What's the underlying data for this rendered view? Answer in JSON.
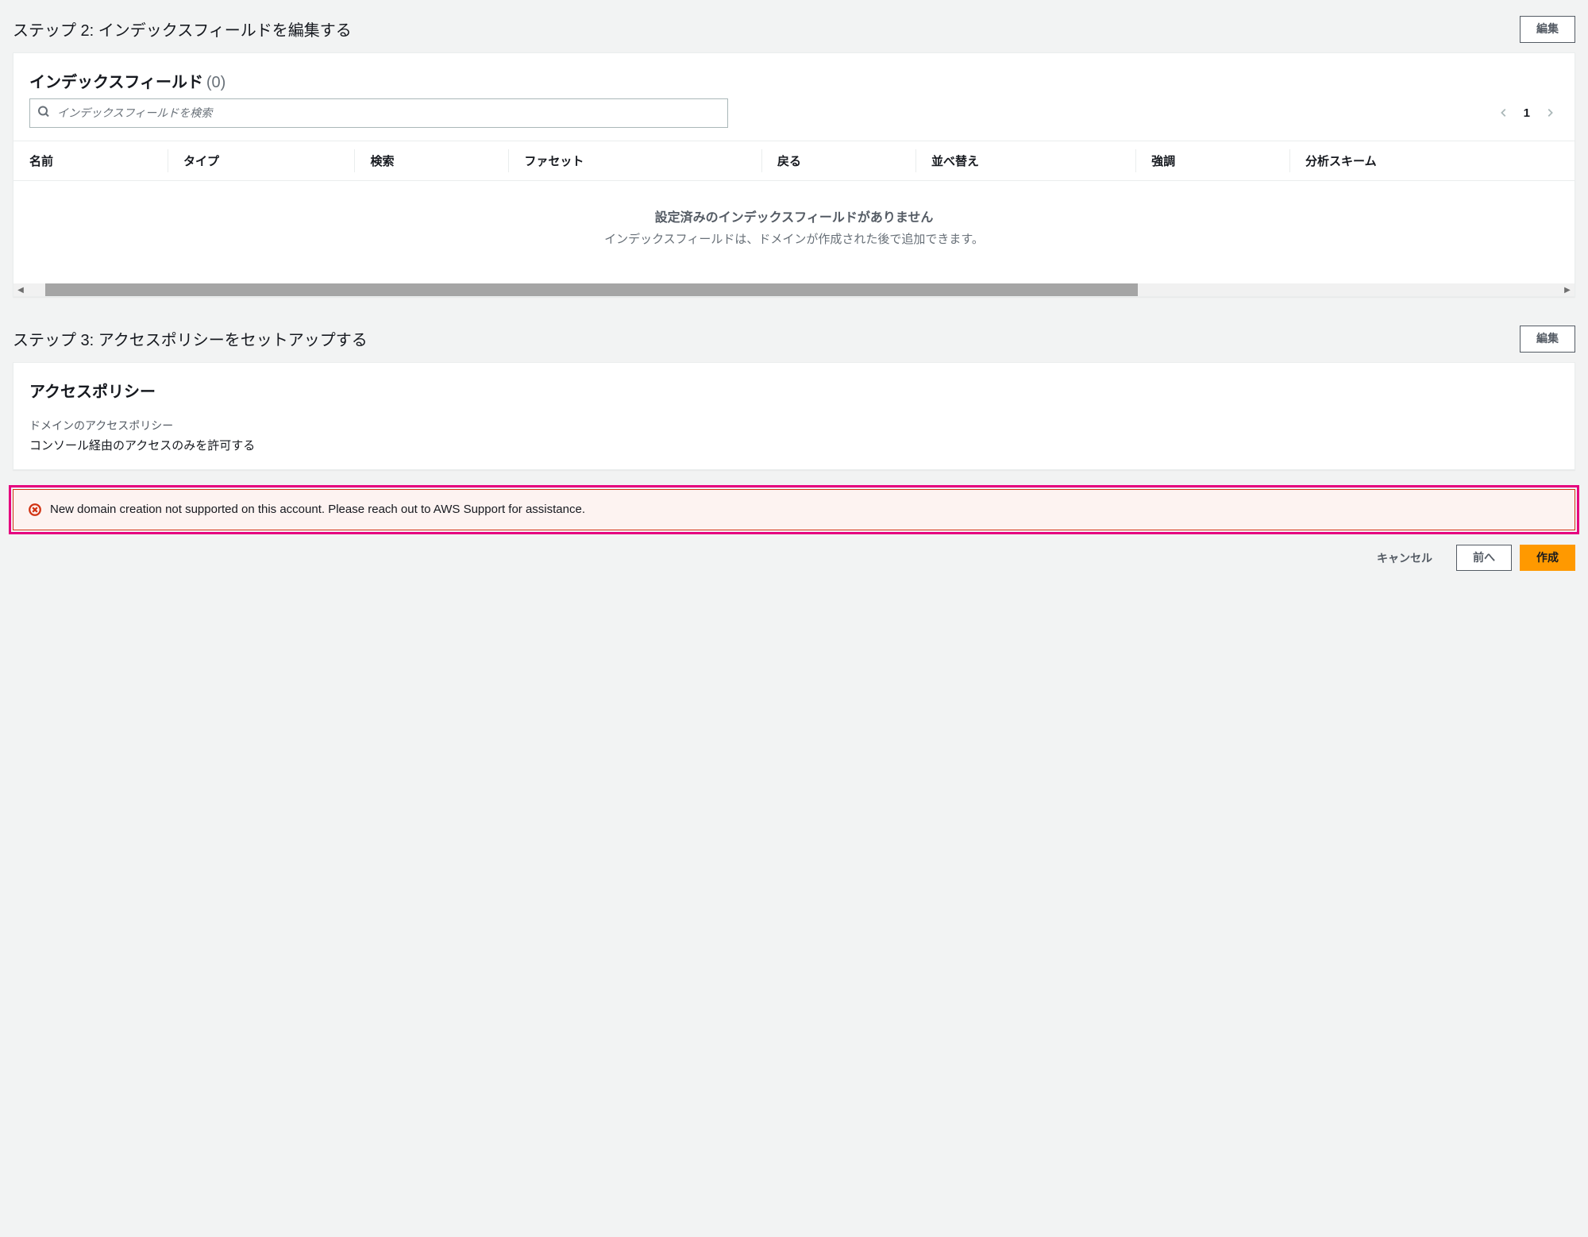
{
  "step2": {
    "title": "ステップ 2: インデックスフィールドを編集する",
    "edit_btn": "編集",
    "panel_title": "インデックスフィールド",
    "count": "(0)",
    "search_placeholder": "インデックスフィールドを検索",
    "page": "1",
    "columns": {
      "name": "名前",
      "type": "タイプ",
      "search": "検索",
      "facet": "ファセット",
      "return": "戻る",
      "sort": "並べ替え",
      "highlight": "強調",
      "analysis": "分析スキーム"
    },
    "empty_title": "設定済みのインデックスフィールドがありません",
    "empty_sub": "インデックスフィールドは、ドメインが作成された後で追加できます。"
  },
  "step3": {
    "title": "ステップ 3: アクセスポリシーをセットアップする",
    "edit_btn": "編集",
    "panel_title": "アクセスポリシー",
    "policy_label": "ドメインのアクセスポリシー",
    "policy_value": "コンソール経由のアクセスのみを許可する"
  },
  "alert": {
    "text": "New domain creation not supported on this account. Please reach out to AWS Support for assistance."
  },
  "footer": {
    "cancel": "キャンセル",
    "prev": "前へ",
    "create": "作成"
  }
}
